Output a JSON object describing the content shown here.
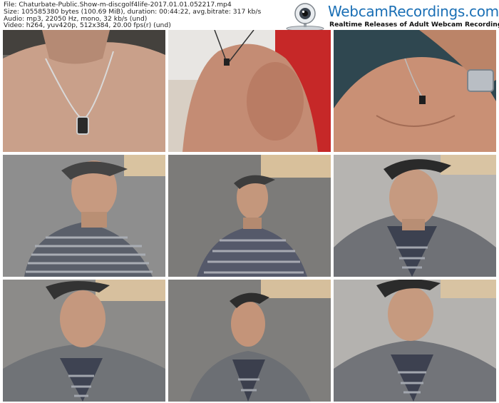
{
  "header": {
    "file_line": "File: Chaturbate-Public.Show-m-discgolf4life-2017.01.01.052217.mp4",
    "size_line": "Size: 105585380 bytes (100.69 MiB), duration: 00:44:22, avg.bitrate: 317 kb/s",
    "audio_line": "Audio: mp3, 22050 Hz, mono, 32 kb/s (und)",
    "video_line": "Video: h264, yuv420p, 512x384, 20.00 fps(r) (und)"
  },
  "brand": {
    "title": "WebcamRecordings.com",
    "subtitle": "Realtime Releases of Adult Webcam Recordings",
    "icon": "webcam-icon",
    "color": "#1a6fb5"
  },
  "thumbnails": [
    {
      "name": "thumb-1",
      "scene": "closeup-chest-necklace"
    },
    {
      "name": "thumb-2",
      "scene": "shirtless-shoulder"
    },
    {
      "name": "thumb-3",
      "scene": "chest-hand-watch"
    },
    {
      "name": "thumb-4",
      "scene": "man-cap-striped-shirt"
    },
    {
      "name": "thumb-5",
      "scene": "man-cap-striped-shirt-far"
    },
    {
      "name": "thumb-6",
      "scene": "man-cap-hoodie"
    },
    {
      "name": "thumb-7",
      "scene": "man-cap-hoodie"
    },
    {
      "name": "thumb-8",
      "scene": "man-cap-hoodie-far"
    },
    {
      "name": "thumb-9",
      "scene": "man-cap-hoodie"
    }
  ]
}
